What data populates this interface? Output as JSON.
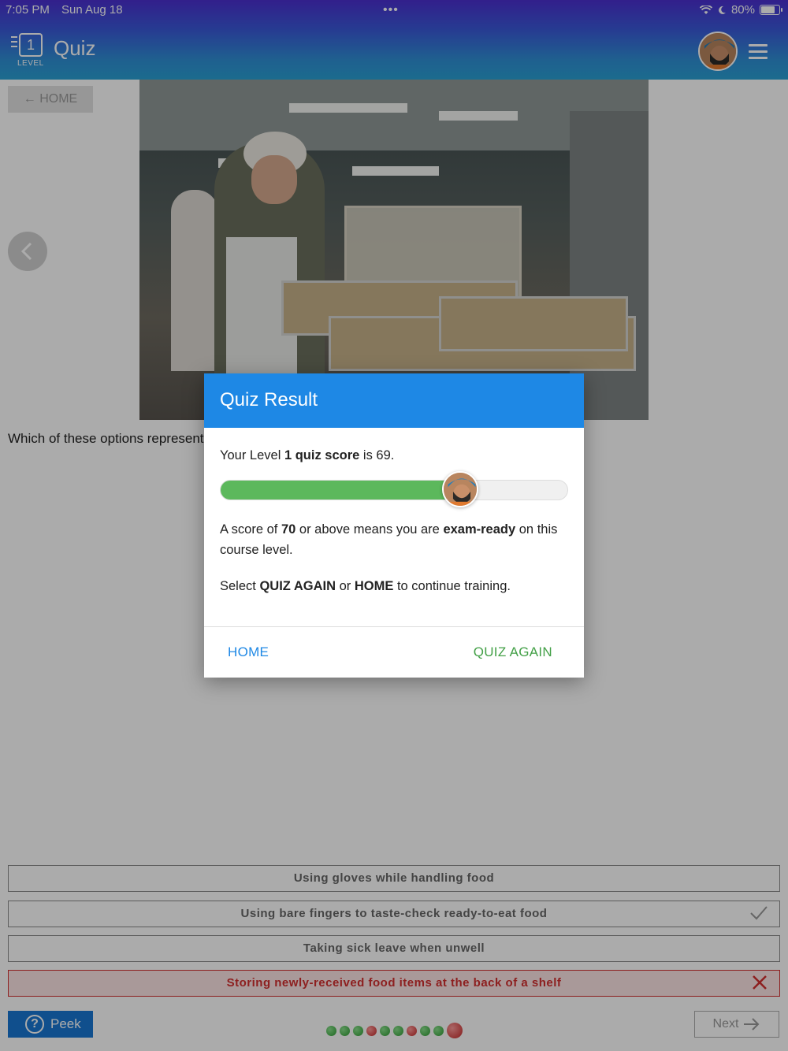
{
  "status_bar": {
    "time": "7:05 PM",
    "date": "Sun Aug 18",
    "more": "•••",
    "battery": "80%",
    "battery_level": 0.8
  },
  "header": {
    "level_number": "1",
    "level_label": "LEVEL",
    "title": "Quiz",
    "icons": [
      "wifi-icon",
      "moon-icon",
      "battery-icon",
      "avatar",
      "hamburger-menu-icon"
    ]
  },
  "page": {
    "home_back_label": "← HOME",
    "question_text": "Which of these options represent",
    "options": [
      {
        "label": "Using gloves while handling food",
        "state": "neutral"
      },
      {
        "label": "Using bare fingers to taste-check ready-to-eat food",
        "state": "correct-answer"
      },
      {
        "label": "Taking sick leave when unwell",
        "state": "neutral"
      },
      {
        "label": "Storing newly-received food items at the back of a shelf",
        "state": "wrong"
      }
    ],
    "peek_label": "Peek",
    "next_label": "Next",
    "progress_dots": [
      "g",
      "g",
      "g",
      "r",
      "g",
      "g",
      "r",
      "g",
      "g",
      "r"
    ]
  },
  "modal": {
    "title": "Quiz Result",
    "score_prefix": "Your Level ",
    "score_level": "1",
    "score_mid": " quiz score",
    "score_suffix": " is 69.",
    "score_value": 69,
    "threshold_value": 70,
    "p2_a": "A score of ",
    "p2_b": "70",
    "p2_c": " or above means you are ",
    "p2_d": "exam-ready",
    "p2_e": " on this course level.",
    "p3_a": "Select ",
    "p3_b": "QUIZ AGAIN",
    "p3_c": " or ",
    "p3_d": "HOME",
    "p3_e": " to continue training.",
    "home_button": "HOME",
    "again_button": "QUIZ AGAIN"
  },
  "colors": {
    "primary": "#1e88e5",
    "success": "#43a047",
    "danger": "#d32f2f"
  }
}
